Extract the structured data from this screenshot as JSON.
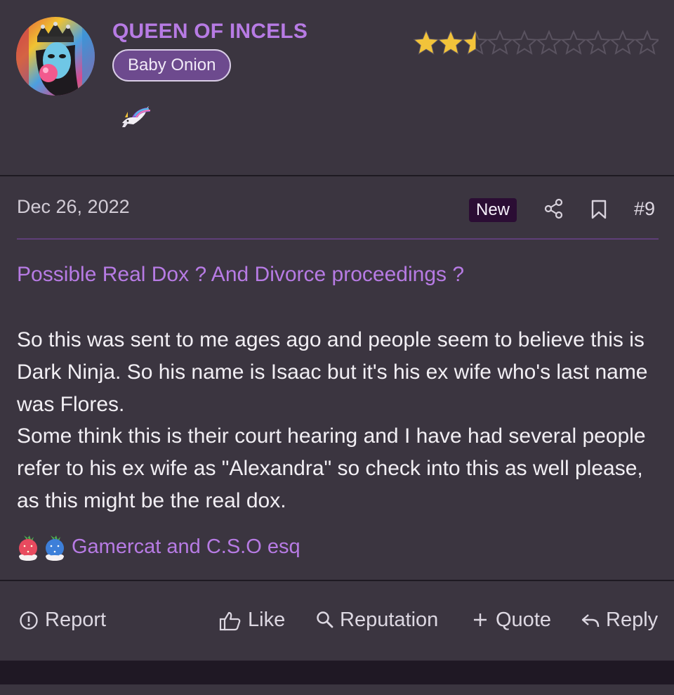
{
  "user": {
    "username": "QUEEN OF INCELS",
    "title": "Baby Onion",
    "avatar_icon": "avatar-queen-image",
    "banner_icon": "unicorn-icon",
    "rating_stars": 2.5,
    "rating_max": 10
  },
  "post": {
    "date": "Dec 26, 2022",
    "new_label": "New",
    "number": "#9",
    "title": "Possible Real Dox ? And Divorce proceedings ?",
    "body_paragraph_1": "So this was sent to me ages ago and people seem to believe this is Dark Ninja. So his name is Isaac but it's his ex wife who's last name was Flores.",
    "body_paragraph_2": "Some think this is their court hearing and I have had several people refer to his ex wife as \"Alexandra\" so check into this as well please, as this might be the real dox."
  },
  "reactions": {
    "icons": [
      "strawberry-cat-icon",
      "blue-cat-icon"
    ],
    "users": "Gamercat and C.S.O esq"
  },
  "actions": {
    "report": "Report",
    "like": "Like",
    "reputation": "Reputation",
    "quote": "Quote",
    "reply": "Reply"
  },
  "colors": {
    "background": "#3b3540",
    "accent_purple": "#b77be4",
    "title_badge": "#6d4a8e",
    "new_badge": "#2b0d34",
    "star_gold": "#f2c33a"
  }
}
